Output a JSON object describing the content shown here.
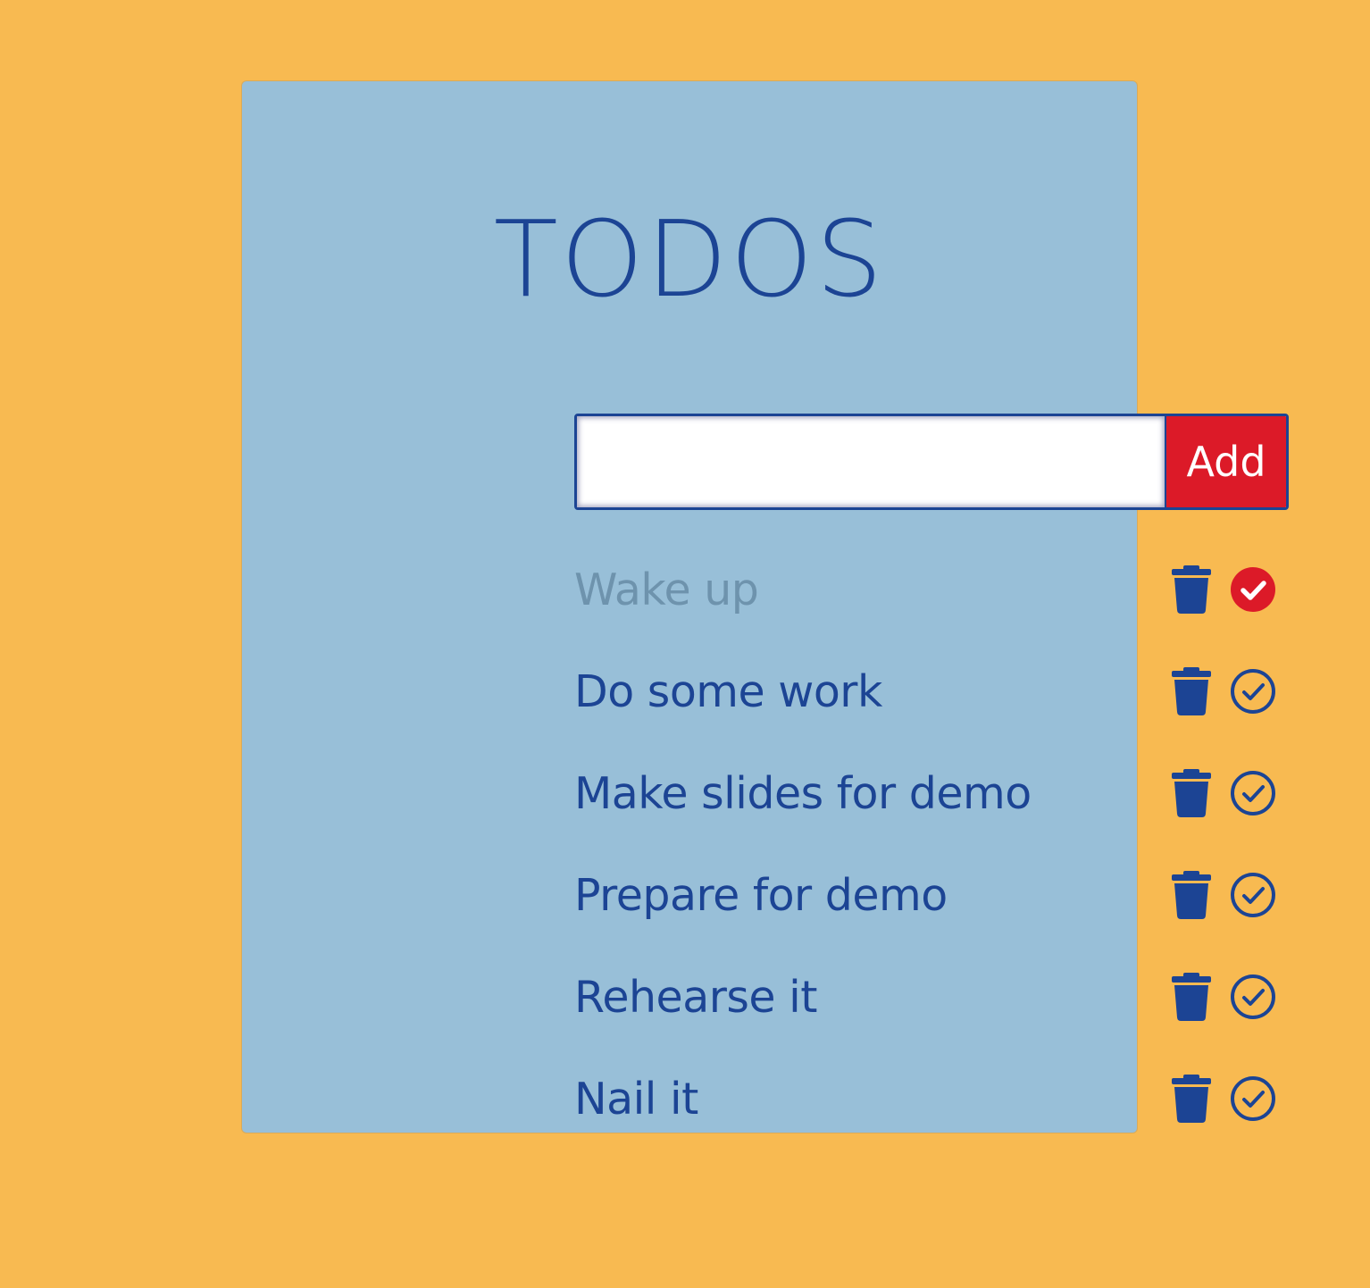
{
  "app": {
    "title": "TODOS"
  },
  "form": {
    "input_value": "",
    "input_placeholder": "",
    "add_label": "Add"
  },
  "todos": [
    {
      "text": "Wake up",
      "completed": true
    },
    {
      "text": "Do some work",
      "completed": false
    },
    {
      "text": "Make slides for demo",
      "completed": false
    },
    {
      "text": "Prepare for demo",
      "completed": false
    },
    {
      "text": "Rehearse it",
      "completed": false
    },
    {
      "text": "Nail it",
      "completed": false
    }
  ],
  "icons": {
    "delete": "trash-icon",
    "complete": "check-circle-icon"
  },
  "colors": {
    "page_background": "#f8ba51",
    "card_background": "#98bfd8",
    "primary": "#1c4494",
    "accent": "#dc1a28",
    "completed_text": "#6e93ad"
  }
}
